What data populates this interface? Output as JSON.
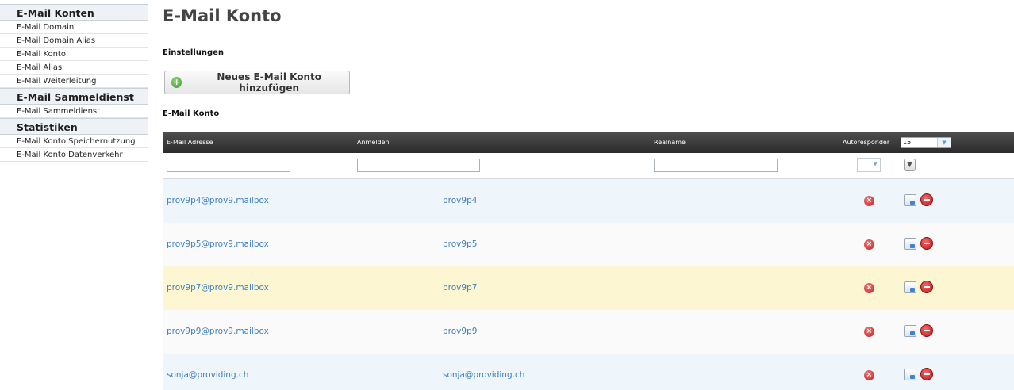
{
  "sidebar": {
    "sections": [
      {
        "title": "E-Mail Konten",
        "items": [
          "E-Mail Domain",
          "E-Mail Domain Alias",
          "E-Mail Konto",
          "E-Mail Alias",
          "E-Mail Weiterleitung"
        ]
      },
      {
        "title": "E-Mail Sammeldienst",
        "items": [
          "E-Mail Sammeldienst"
        ]
      },
      {
        "title": "Statistiken",
        "items": [
          "E-Mail Konto Speichernutzung",
          "E-Mail Konto Datenverkehr"
        ]
      }
    ]
  },
  "page": {
    "title": "E-Mail Konto",
    "settings_label": "Einstellungen",
    "add_button_label": "Neues E-Mail Konto hinzufügen",
    "grid_label": "E-Mail Konto"
  },
  "grid": {
    "columns": {
      "email": "E-Mail Adresse",
      "login": "Anmelden",
      "realname": "Realname",
      "autoresponder": "Autoresponder"
    },
    "page_size": "15",
    "rows": [
      {
        "email": "prov9p4@prov9.mailbox",
        "login": "prov9p4",
        "realname": "",
        "style": "blue"
      },
      {
        "email": "prov9p5@prov9.mailbox",
        "login": "prov9p5",
        "realname": "",
        "style": "grey"
      },
      {
        "email": "prov9p7@prov9.mailbox",
        "login": "prov9p7",
        "realname": "",
        "style": "yellow"
      },
      {
        "email": "prov9p9@prov9.mailbox",
        "login": "prov9p9",
        "realname": "",
        "style": "grey"
      },
      {
        "email": "sonja@providing.ch",
        "login": "sonja@providing.ch",
        "realname": "",
        "style": "blue"
      }
    ]
  },
  "icons": {
    "add": "plus-circle-icon",
    "autoresponder_off": "x-circle-icon",
    "edit": "edit-icon",
    "delete": "delete-icon",
    "filter": "filter-icon",
    "dropdown": "chevron-down-icon"
  },
  "colors": {
    "link": "#3f7fbf",
    "row_blue": "#eef5fb",
    "row_yellow": "#fcf6d2",
    "header_bg": "#3a3a3a"
  }
}
